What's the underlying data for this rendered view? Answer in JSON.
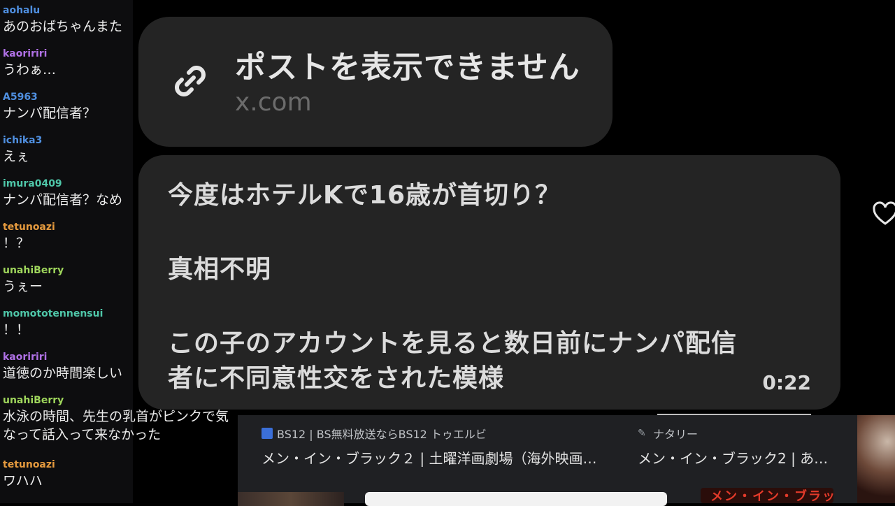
{
  "chat": {
    "messages": [
      {
        "user": "aohalu",
        "color": "#4f8fe0",
        "text": "あのおばちゃんまた"
      },
      {
        "user": "kaoririri",
        "color": "#b071e6",
        "text": "うわぁ…"
      },
      {
        "user": "A5963",
        "color": "#4f8fe0",
        "text": "ナンパ配信者？"
      },
      {
        "user": "ichika3",
        "color": "#4f8fe0",
        "text": "えぇ"
      },
      {
        "user": "imura0409",
        "color": "#4fc7a9",
        "text": "ナンパ配信者？なめ"
      },
      {
        "user": "tetunoazi",
        "color": "#e59a3e",
        "text": "！？"
      },
      {
        "user": "unahiBerry",
        "color": "#9fd65c",
        "text": "うぇー"
      },
      {
        "user": "momototennensui",
        "color": "#4fc7a9",
        "text": "！！"
      },
      {
        "user": "kaoririri",
        "color": "#b071e6",
        "text": "道徳のか時間楽しい"
      },
      {
        "user": "unahiBerry",
        "color": "#9fd65c",
        "text": "水泳の時間、先生の乳首がピンクで気\nなって話入って来なかった"
      },
      {
        "user": "tetunoazi",
        "color": "#e59a3e",
        "text": "ワハハ"
      }
    ]
  },
  "link_card": {
    "icon": "link-icon",
    "title": "ポストを表示できません",
    "domain": "x.com"
  },
  "tweet": {
    "lines": [
      "今度はホテルKで16歳が首切り？",
      "真相不明",
      "この子のアカウントを見ると数日前にナンパ配信",
      "者に不同意性交をされた模様"
    ],
    "video_time": "0:22"
  },
  "heart_icon": "heart-icon",
  "search_results": [
    {
      "source": "BS12 | BS無料放送ならBS12 トゥエルビ",
      "title": "メン・イン・ブラック２ | 土曜洋画劇場（海外映画…",
      "favicon_color": "#3b6fd8"
    },
    {
      "source": "ナタリー",
      "title": "メン・イン・ブラック2 | あ…",
      "favicon_color": "#9aa0a6"
    }
  ],
  "poster_title": "メン・イン・ブラック"
}
